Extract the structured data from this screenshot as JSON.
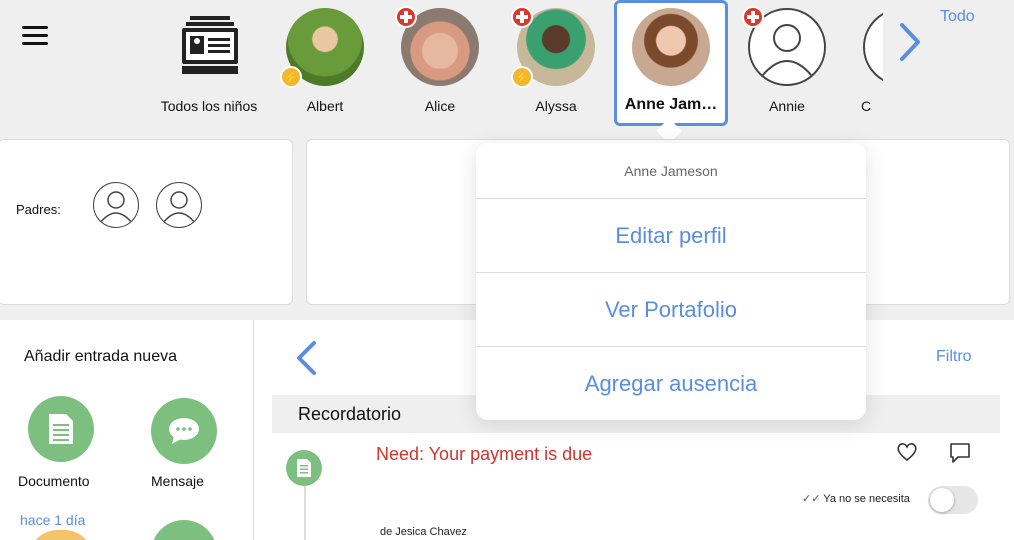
{
  "topbar": {
    "menu_icon": "hamburger-menu-icon",
    "todo_link": "Todo",
    "next_icon": "chevron-right-icon",
    "children": [
      {
        "label": "Todos los niños",
        "icon": "roster-card-icon"
      },
      {
        "label": "Albert",
        "badges": [
          "bolt"
        ]
      },
      {
        "label": "Alice",
        "badges": [
          "plus"
        ]
      },
      {
        "label": "Alyssa",
        "badges": [
          "plus",
          "bolt"
        ]
      },
      {
        "label": "Anne Jam…",
        "selected": true
      },
      {
        "label": "Annie",
        "badges": [
          "plus"
        ],
        "icon": "user-placeholder-icon"
      },
      {
        "label": "C"
      }
    ]
  },
  "parents": {
    "label": "Padres:"
  },
  "popover": {
    "header": "Anne Jameson",
    "items": [
      "Editar perfil",
      "Ver Portafolio",
      "Agregar ausencia"
    ]
  },
  "left_panel": {
    "title": "Añadir entrada nueva",
    "document_label": "Documento",
    "message_label": "Mensaje",
    "ago": "hace 1 día"
  },
  "right_panel": {
    "back_icon": "chevron-left-icon",
    "filter_link": "Filtro",
    "section_title": "Recordatorio",
    "entry_title": "Need: Your payment is due",
    "not_needed_label": "Ya no se necesita",
    "author": "de Jesica Chavez"
  },
  "colors": {
    "accent": "#5a8ee0",
    "green": "#7dbf7f",
    "alert_red": "#d0342c",
    "badge_red": "#d8382e",
    "badge_yellow": "#f2b731"
  }
}
